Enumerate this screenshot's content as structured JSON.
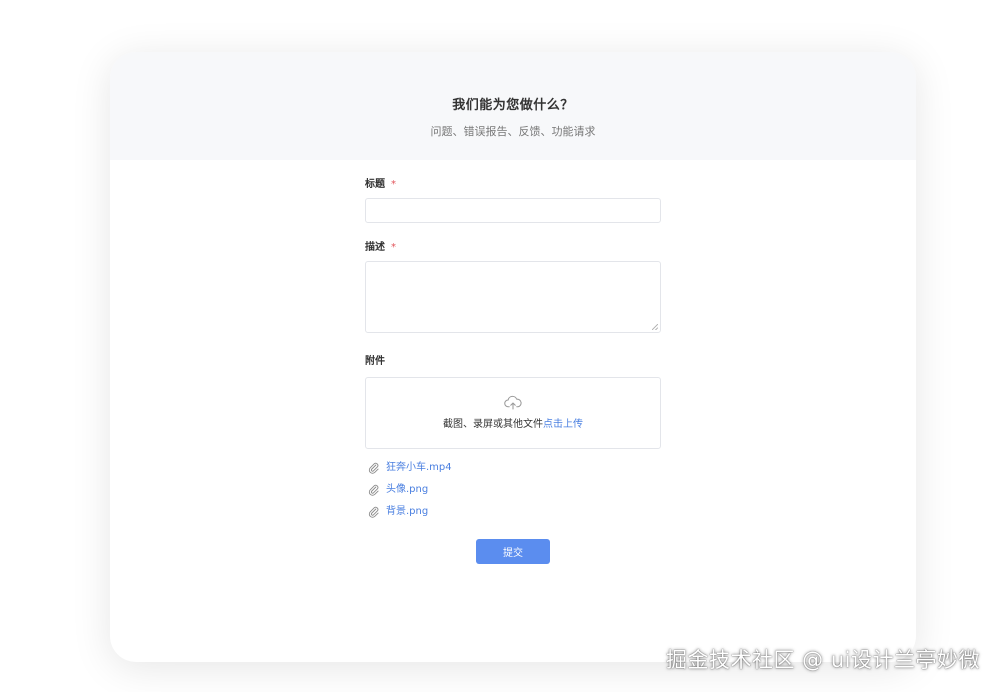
{
  "header": {
    "title": "我们能为您做什么？",
    "subtitle": "问题、错误报告、反馈、功能请求"
  },
  "form": {
    "title_label": "标题",
    "title_required_mark": "*",
    "title_value": "",
    "description_label": "描述",
    "description_required_mark": "*",
    "description_value": "",
    "attachments_label": "附件",
    "upload": {
      "icon": "cloud-upload-icon",
      "text": "截图、录屏或其他文件",
      "link_text": "点击上传"
    },
    "files": [
      {
        "icon": "paperclip-icon",
        "name": "狂奔小车.mp4"
      },
      {
        "icon": "paperclip-icon",
        "name": "头像.png"
      },
      {
        "icon": "paperclip-icon",
        "name": "背景.png"
      }
    ],
    "submit_label": "提交"
  },
  "watermark": "掘金技术社区 @ ui设计兰亭妙微",
  "colors": {
    "accent": "#5b8def",
    "link": "#4a7fe0",
    "required": "#e2555b",
    "header_bg": "#f7f8fa"
  }
}
